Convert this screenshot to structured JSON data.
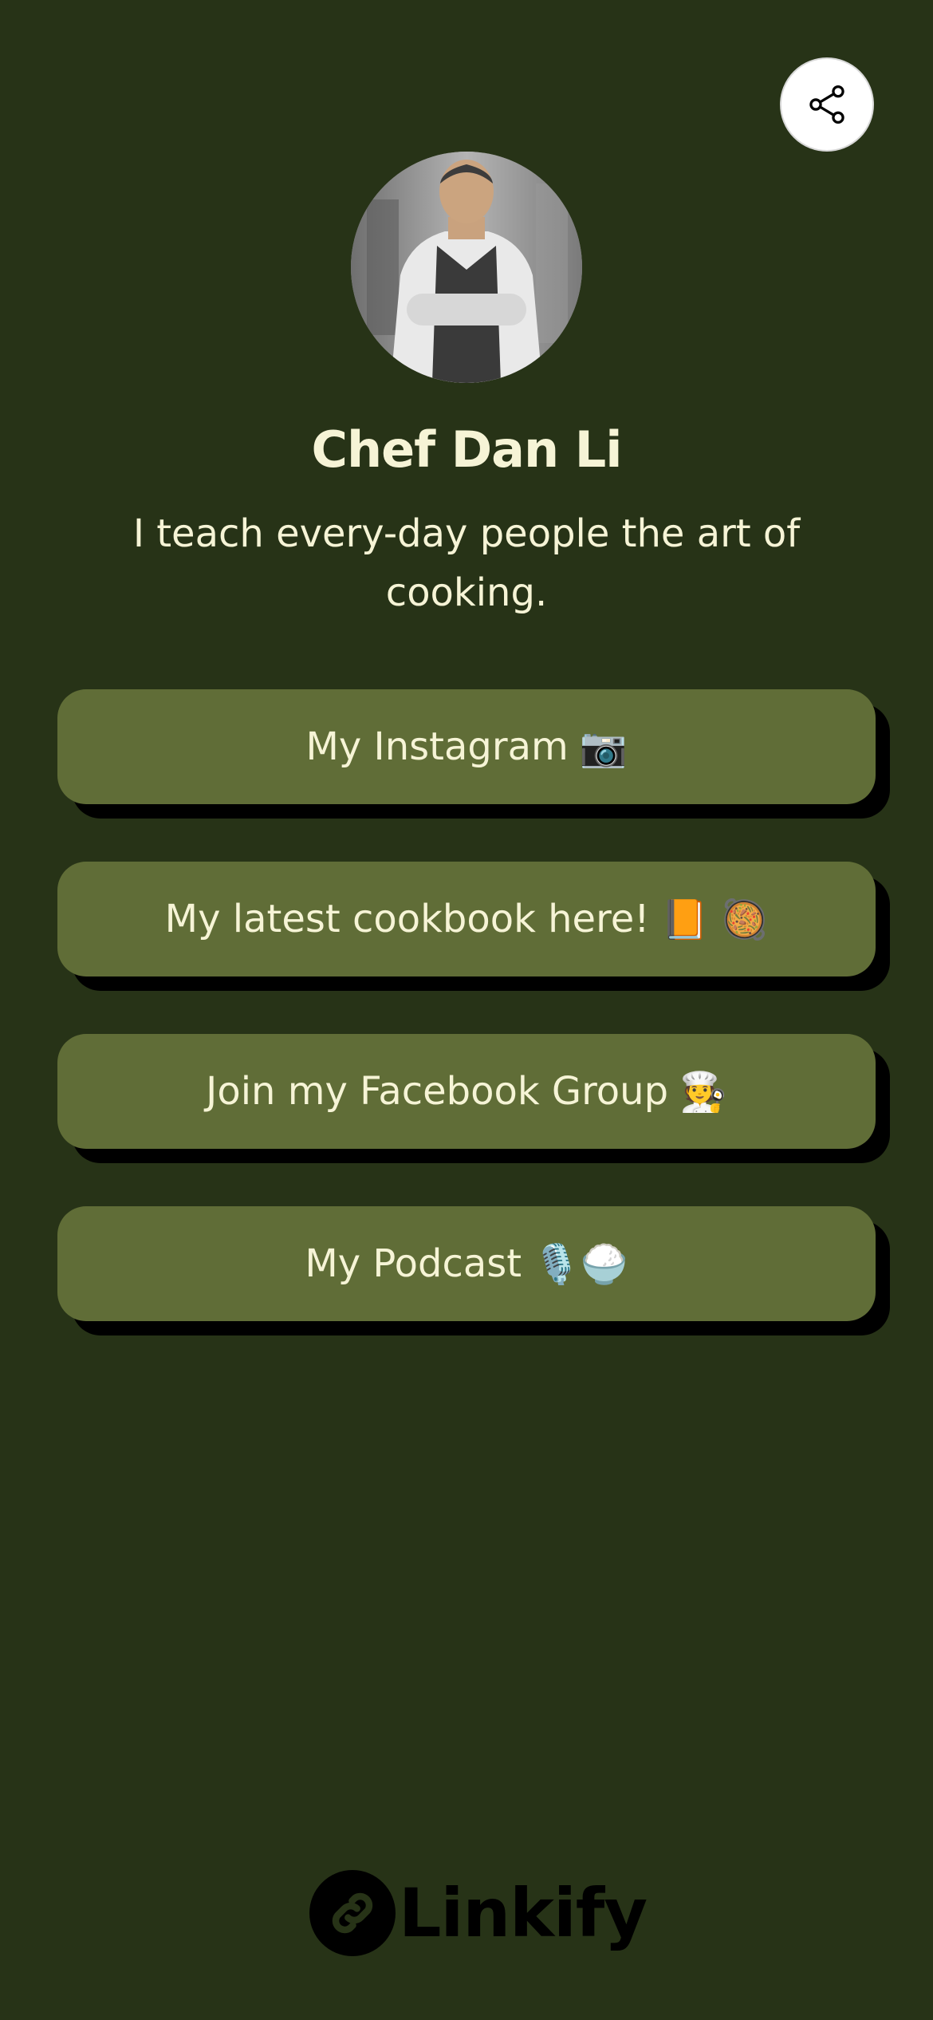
{
  "profile": {
    "name": "Chef Dan Li",
    "bio": "I teach every-day people the art of cooking."
  },
  "header": {
    "share_icon": "share-icon"
  },
  "links": [
    {
      "label": "My Instagram",
      "emoji": "📷"
    },
    {
      "label": "My latest cookbook here!",
      "emoji": "📙 🥘"
    },
    {
      "label": "Join my Facebook Group",
      "emoji": "🧑‍🍳"
    },
    {
      "label": "My Podcast",
      "emoji": "🎙️🍚"
    }
  ],
  "footer": {
    "brand": "Linkify",
    "logo_icon": "link-icon"
  },
  "colors": {
    "background": "#273317",
    "button": "#606d37",
    "button_shadow": "#000000",
    "text": "#f6f4d6"
  }
}
